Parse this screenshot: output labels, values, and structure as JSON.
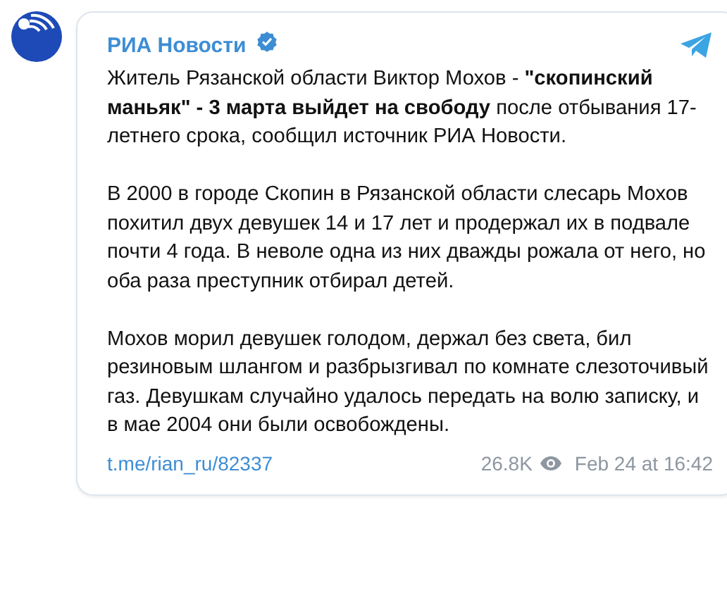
{
  "channel": {
    "name": "РИА Новости",
    "verified": true
  },
  "post": {
    "paragraphs": [
      "Житель Рязанской области Виктор Мохов - **\"скопинский маньяк\" - 3 марта выйдет на свободу** после отбывания 17-летнего срока, сообщил источник РИА Новости.",
      "В 2000 в городе Скопин в Рязанской области слесарь Мохов похитил двух девушек 14 и 17 лет и продержал их в подвале почти 4 года. В неволе одна из них дважды рожала от него, но оба раза преступник отбирал детей.",
      "Мохов морил девушек голодом, держал без света, бил резиновым шлангом и разбрызгивал по комнате слезоточивый газ. Девушкам случайно удалось передать на волю записку, и в мае 2004 они были освобождены."
    ]
  },
  "footer": {
    "link": "t.me/rian_ru/82337",
    "views": "26.8K",
    "date": "Feb 24 at 16:42"
  }
}
